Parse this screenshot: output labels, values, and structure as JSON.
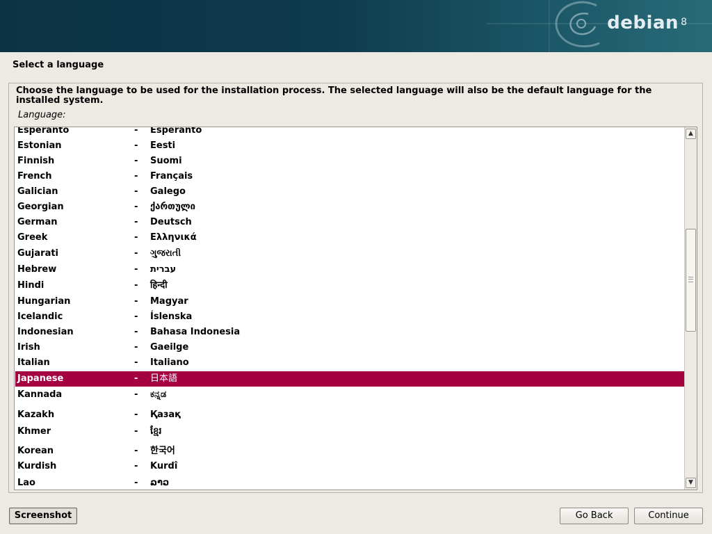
{
  "header": {
    "brand": "debian",
    "version": "8"
  },
  "page": {
    "title": "Select a language",
    "description": "Choose the language to be used for the installation process. The selected language will also be the default language for the installed system.",
    "field_label": "Language:"
  },
  "languages": [
    {
      "name": "Esperanto",
      "native": "Esperanto"
    },
    {
      "name": "Estonian",
      "native": "Eesti"
    },
    {
      "name": "Finnish",
      "native": "Suomi"
    },
    {
      "name": "French",
      "native": "Français"
    },
    {
      "name": "Galician",
      "native": "Galego"
    },
    {
      "name": "Georgian",
      "native": "ქართული"
    },
    {
      "name": "German",
      "native": "Deutsch"
    },
    {
      "name": "Greek",
      "native": "Ελληνικά"
    },
    {
      "name": "Gujarati",
      "native": "ગુજરાતી"
    },
    {
      "name": "Hebrew",
      "native": "עברית"
    },
    {
      "name": "Hindi",
      "native": "हिन्दी"
    },
    {
      "name": "Hungarian",
      "native": "Magyar"
    },
    {
      "name": "Icelandic",
      "native": "Íslenska"
    },
    {
      "name": "Indonesian",
      "native": "Bahasa Indonesia"
    },
    {
      "name": "Irish",
      "native": "Gaeilge"
    },
    {
      "name": "Italian",
      "native": "Italiano"
    },
    {
      "name": "Japanese",
      "native": "日本語"
    },
    {
      "name": "Kannada",
      "native": "ಕನ್ನಡ"
    },
    {
      "name": "Kazakh",
      "native": "Қазақ"
    },
    {
      "name": "Khmer",
      "native": "ខ្មែរ"
    },
    {
      "name": "Korean",
      "native": "한국어"
    },
    {
      "name": "Kurdish",
      "native": "Kurdî"
    },
    {
      "name": "Lao",
      "native": "ລາວ"
    }
  ],
  "separator": "-",
  "selected_language": "Japanese",
  "colors": {
    "selection": "#a50040",
    "banner": "#0d3a4c"
  },
  "buttons": {
    "screenshot": "Screenshot",
    "go_back": "Go Back",
    "continue": "Continue"
  },
  "scrollbar": {
    "up_icon": "arrow-up-icon",
    "down_icon": "arrow-down-icon"
  }
}
